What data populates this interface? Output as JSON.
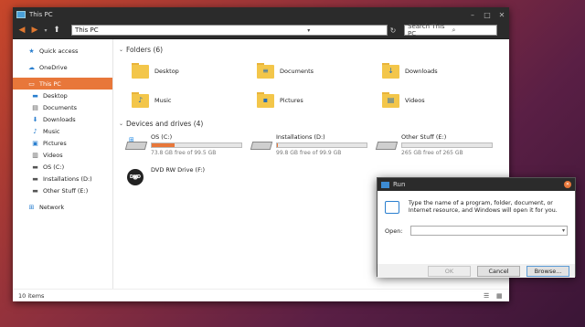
{
  "explorer": {
    "title": "This PC",
    "address": "This PC",
    "search_placeholder": "Search This PC",
    "status": "10 items"
  },
  "sidebar": {
    "items": [
      {
        "label": "Quick access",
        "icon": "star-icon",
        "level": 0
      },
      {
        "label": "OneDrive",
        "icon": "cloud-icon",
        "level": 0
      },
      {
        "label": "This PC",
        "icon": "computer-icon",
        "level": 0,
        "selected": true
      },
      {
        "label": "Desktop",
        "icon": "desktop-icon",
        "level": 1
      },
      {
        "label": "Documents",
        "icon": "document-icon",
        "level": 1
      },
      {
        "label": "Downloads",
        "icon": "download-icon",
        "level": 1
      },
      {
        "label": "Music",
        "icon": "music-icon",
        "level": 1
      },
      {
        "label": "Pictures",
        "icon": "picture-icon",
        "level": 1
      },
      {
        "label": "Videos",
        "icon": "video-icon",
        "level": 1
      },
      {
        "label": "OS (C:)",
        "icon": "drive-icon",
        "level": 1
      },
      {
        "label": "Installations (D:)",
        "icon": "drive-icon",
        "level": 1
      },
      {
        "label": "Other Stuff (E:)",
        "icon": "drive-icon",
        "level": 1
      },
      {
        "label": "Network",
        "icon": "network-icon",
        "level": 0
      }
    ]
  },
  "folders": {
    "heading": "Folders (6)",
    "items": [
      {
        "label": "Desktop",
        "badge": ""
      },
      {
        "label": "Documents",
        "badge": "≡"
      },
      {
        "label": "Downloads",
        "badge": "↓"
      },
      {
        "label": "Music",
        "badge": "♪"
      },
      {
        "label": "Pictures",
        "badge": "▪"
      },
      {
        "label": "Videos",
        "badge": "▤"
      }
    ]
  },
  "drives": {
    "heading": "Devices and drives (4)",
    "items": [
      {
        "name": "OS (C:)",
        "free": "73.8 GB free of 99.5 GB",
        "used_fraction": 0.26,
        "type": "os"
      },
      {
        "name": "Installations (D:)",
        "free": "99.8 GB free of 99.9 GB",
        "used_fraction": 0.01,
        "type": "hdd"
      },
      {
        "name": "Other Stuff (E:)",
        "free": "265 GB free of 265 GB",
        "used_fraction": 0.0,
        "type": "hdd"
      },
      {
        "name": "DVD RW Drive (F:)",
        "free": "",
        "type": "dvd",
        "dvd_text": "DVD"
      }
    ]
  },
  "run": {
    "title": "Run",
    "description": "Type the name of a program, folder, document, or Internet resource, and Windows will open it for you.",
    "open_label": "Open:",
    "open_value": "",
    "ok": "OK",
    "cancel": "Cancel",
    "browse": "Browse..."
  },
  "colors": {
    "accent": "#e8773a",
    "titlebar": "#2b2b2b"
  }
}
